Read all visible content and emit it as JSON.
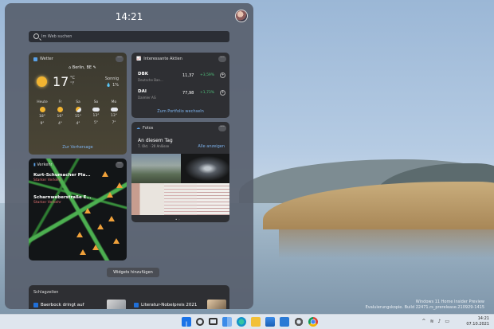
{
  "widgets_panel": {
    "time": "14:21",
    "search_placeholder": "Im Web suchen",
    "add_widgets_label": "Widgets hinzufügen",
    "more_glyph": "···"
  },
  "weather": {
    "title": "Wetter",
    "location": "Berlin, BE",
    "temperature": "17",
    "unit_c": "°C",
    "unit_f": "°F",
    "condition": "Sonnig",
    "precip": "1%",
    "forecast_link": "Zur Vorhersage",
    "days": [
      {
        "name": "Heute",
        "icon": "sun-icon",
        "high": "18°",
        "low": "9°"
      },
      {
        "name": "Fr",
        "icon": "sun-icon",
        "high": "16°",
        "low": "4°"
      },
      {
        "name": "Sa",
        "icon": "partly-cloudy-icon",
        "high": "15°",
        "low": "4°"
      },
      {
        "name": "So",
        "icon": "cloud-icon",
        "high": "13°",
        "low": "5°"
      },
      {
        "name": "Mo",
        "icon": "cloud-icon",
        "high": "13°",
        "low": "7°"
      }
    ]
  },
  "stocks": {
    "title": "Interessante Aktien",
    "items": [
      {
        "symbol": "DBK",
        "name": "Deutsche Ban...",
        "price": "11,37",
        "change": "+3,59%"
      },
      {
        "symbol": "DAI",
        "name": "Daimler AG",
        "price": "77,98",
        "change": "+1,73%"
      }
    ],
    "portfolio_link": "Zum Portfolio wechseln"
  },
  "photos": {
    "title": "Fotos",
    "heading": "An diesem Tag",
    "subtitle": "7. Okt. · 20 Anlässe",
    "show_all": "Alle anzeigen",
    "pager": "• ◦"
  },
  "traffic": {
    "title": "Verkehr",
    "routes": [
      {
        "road": "Kurt-Schumacher Pla...",
        "status": "Starker Verkehr"
      },
      {
        "road": "Scharnweberstraße E...",
        "status": "Starker Verkehr"
      }
    ]
  },
  "news": {
    "title": "Schlagzeilen",
    "items": [
      {
        "headline": "Baerbock dringt auf"
      },
      {
        "headline": "Literatur-Nobelpreis 2021"
      }
    ]
  },
  "desktop": {
    "watermark_line1": "Windows 11 Home Insider Preview",
    "watermark_line2": "Evaluierungskopie. Build 22471.rs_prerelease.210929-1415"
  },
  "taskbar": {
    "clock_time": "14:21",
    "clock_date": "07.10.2021",
    "icons": [
      "windows-start-icon",
      "search-icon",
      "task-view-icon",
      "widgets-icon",
      "edge-icon",
      "file-explorer-icon",
      "store-icon",
      "mail-icon",
      "settings-icon",
      "chrome-icon"
    ],
    "colors": {
      "start": "#1a73e8",
      "edge": "#1592c9",
      "explorer": "#f2c037",
      "chrome": "#db4437"
    }
  }
}
